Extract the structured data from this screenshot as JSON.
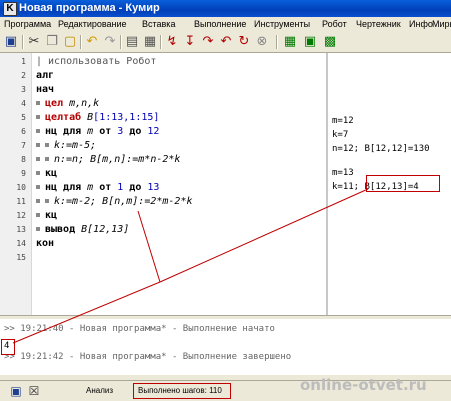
{
  "window": {
    "icon_letter": "K",
    "title": "Новая программа - Кумир"
  },
  "menu": [
    "Программа",
    "Редактирование",
    "Вставка",
    "Выполнение",
    "Инструменты",
    "Робот",
    "Чертежник",
    "Инфо",
    "Миры"
  ],
  "toolbar_icons": [
    "save-icon",
    "cut-icon",
    "copy-icon",
    "paste-icon",
    "undo-icon",
    "redo-icon",
    "document-icon",
    "properties-icon",
    "run-icon",
    "step-icon",
    "step-into-icon",
    "step-out-icon",
    "stop-icon",
    "grid-icon",
    "field-icon",
    "robot-grid-icon"
  ],
  "editor": {
    "line_numbers": [
      "1",
      "2",
      "3",
      "4",
      "5",
      "6",
      "7",
      "8",
      "9",
      "10",
      "11",
      "12",
      "13",
      "14",
      "15"
    ],
    "lines": {
      "l1": "| использовать Робот",
      "l2": "алг",
      "l3": "нач",
      "l4_kw": "цел",
      "l4_rest": " m,n,k",
      "l5_kw": "целтаб",
      "l5_arr": " B",
      "l5_rest": "[1:13,1:15]",
      "l6_kw": "нц для",
      "l6_var": " m ",
      "l6_from": "от",
      "l6_a": " 3 ",
      "l6_to": "до",
      "l6_b": " 12",
      "l7": "k:=m-5;",
      "l8_a": "n:=n; ",
      "l8_b": "B[m,n]:=m*n-2*k",
      "l9": "кц",
      "l10_kw": "нц для",
      "l10_var": " m ",
      "l10_from": "от",
      "l10_a": " 1 ",
      "l10_to": "до",
      "l10_b": " 13",
      "l11_a": "k:=m-2; ",
      "l11_b": "B[n,m]:=2*m-2*k",
      "l12": "кц",
      "l13_kw": "вывод",
      "l13_rest": " B[12,13]",
      "l14": "кон"
    }
  },
  "margin_output": {
    "r1": "m=12",
    "r2": "k=7",
    "r3": "n=12; B[12,12]=130",
    "r4": "m=13",
    "r5a": "k=11; ",
    "r5b": "B[12,13]=4"
  },
  "console": {
    "line1": ">> 19:21:40 - Новая программа* - Выполнение начато",
    "output_value": "4",
    "line2": ">> 19:21:42 - Новая программа* - Выполнение завершено"
  },
  "status": {
    "mode": "Анализ",
    "steps": "Выполнено шагов: 110"
  },
  "watermark": "online-otvet.ru",
  "colors": {
    "annotation_red": "#c00000",
    "keyword_red": "#b40000",
    "titlebar_blue": "#0a5fdb"
  }
}
